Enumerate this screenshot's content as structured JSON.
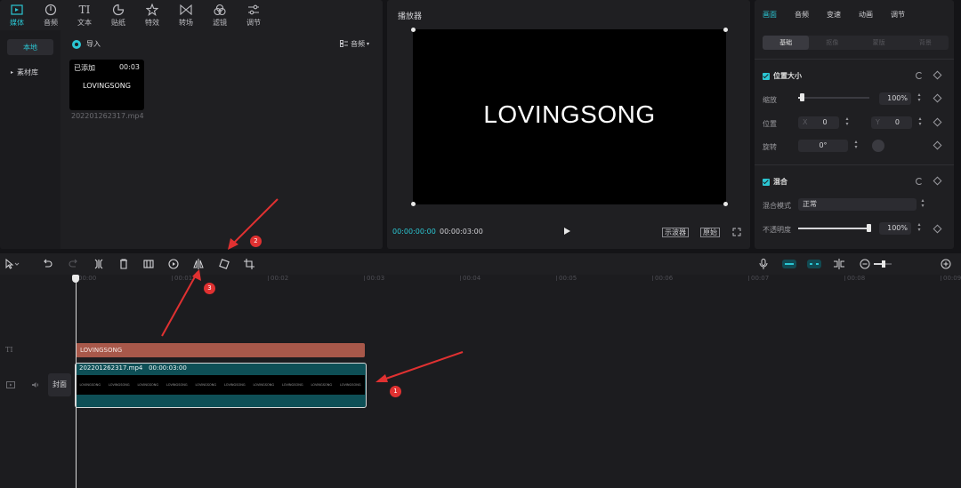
{
  "media_tabs": [
    {
      "label": "媒体",
      "icon": "media-icon"
    },
    {
      "label": "音频",
      "icon": "audio-icon"
    },
    {
      "label": "文本",
      "icon": "text-icon"
    },
    {
      "label": "贴纸",
      "icon": "sticker-icon"
    },
    {
      "label": "特效",
      "icon": "effects-icon"
    },
    {
      "label": "转场",
      "icon": "transition-icon"
    },
    {
      "label": "滤镜",
      "icon": "filter-icon"
    },
    {
      "label": "调节",
      "icon": "adjust-icon"
    }
  ],
  "media_sidebar": {
    "local": "本地",
    "library": "素材库"
  },
  "media_main": {
    "import_label": "导入",
    "sort_label": "音频",
    "clip": {
      "added": "已添加",
      "duration": "00:03",
      "title": "LOVINGSONG",
      "filename": "202201262317.mp4"
    }
  },
  "player": {
    "title": "播放器",
    "screen_text": "LOVINGSONG",
    "current_time": "00:00:00:00",
    "total_time": "00:00:03:00",
    "btn_scope": "示波器",
    "btn_original": "原始"
  },
  "props": {
    "tabs": [
      "画面",
      "音频",
      "变速",
      "动画",
      "调节"
    ],
    "sub_tabs": [
      "基础",
      "抠像",
      "蒙版",
      "背景"
    ],
    "section_position": "位置大小",
    "scale_label": "缩放",
    "scale_value": "100%",
    "scale_level": 0.05,
    "position_label": "位置",
    "x_prefix": "X",
    "x_value": "0",
    "y_prefix": "Y",
    "y_value": "0",
    "rotate_label": "旋转",
    "rotate_value": "0°",
    "section_blend": "混合",
    "blend_mode_label": "混合模式",
    "blend_mode_value": "正常",
    "opacity_label": "不透明度",
    "opacity_value": "100%",
    "opacity_level": 1.0
  },
  "timeline": {
    "ruler": [
      "00:00",
      "00:01",
      "00:02",
      "00:03",
      "00:04",
      "00:05",
      "00:06",
      "00:07",
      "00:08",
      "00:09"
    ],
    "cover_label": "封面",
    "text_clip": "LOVINGSONG",
    "video_clip_name": "202201262317.mp4",
    "video_clip_duration": "00:00:03:00",
    "frame_text": "LOVINGSONG",
    "frame_count": 10
  },
  "annotations": [
    "1",
    "2",
    "3"
  ],
  "colors": {
    "accent": "#2bc6d3",
    "text_clip": "#a8584a",
    "video_clip": "#0e4f56",
    "marker": "#e03131"
  }
}
